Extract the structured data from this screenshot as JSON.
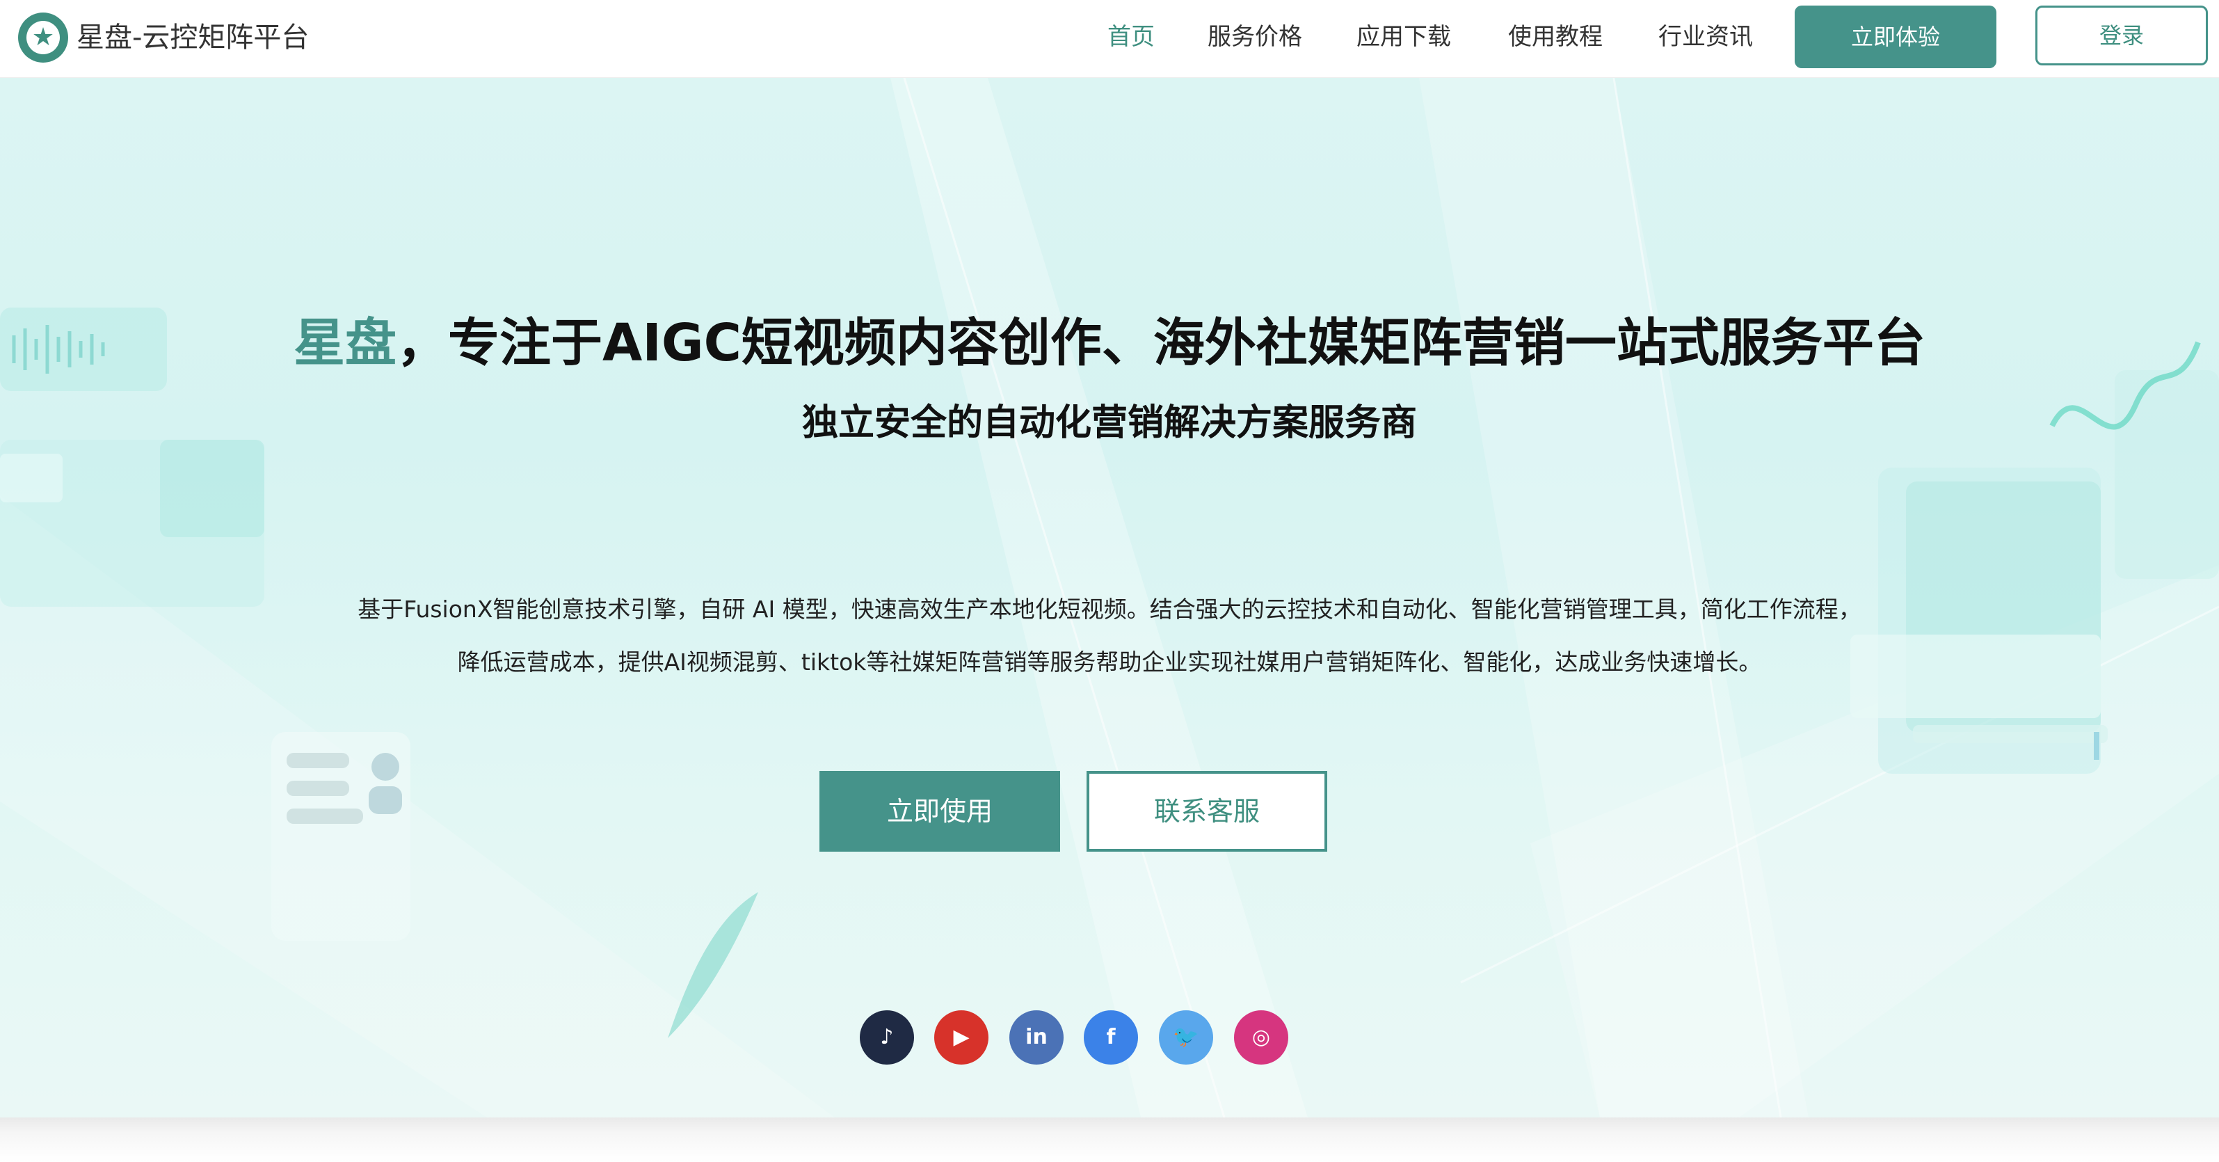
{
  "header": {
    "logo_text": "星盘-云控矩阵平台",
    "nav": [
      {
        "label": "首页",
        "active": true
      },
      {
        "label": "服务价格",
        "active": false
      },
      {
        "label": "应用下载",
        "active": false
      },
      {
        "label": "使用教程",
        "active": false
      },
      {
        "label": "行业资讯",
        "active": false
      }
    ],
    "cta_label": "立即体验",
    "login_label": "登录"
  },
  "hero": {
    "headline_brand": "星盘",
    "headline_rest": "，专注于AIGC短视频内容创作、海外社媒矩阵营销一站式服务平台",
    "subheadline": "独立安全的自动化营销解决方案服务商",
    "description_line1": "基于FusionX智能创意技术引擎，自研 AI 模型，快速高效生产本地化短视频。结合强大的云控技术和自动化、智能化营销管理工具，简化工作流程，",
    "description_line2": "降低运营成本，提供AI视频混剪、tiktok等社媒矩阵营销等服务帮助企业实现社媒用户营销矩阵化、智能化，达成业务快速增长。",
    "primary_button": "立即使用",
    "secondary_button": "联系客服"
  },
  "social": [
    {
      "name": "tiktok-icon",
      "glyph": "♪",
      "color": "#1f2a44"
    },
    {
      "name": "youtube-icon",
      "glyph": "▶",
      "color": "#d7322a"
    },
    {
      "name": "linkedin-icon",
      "glyph": "in",
      "color": "#4b72b6"
    },
    {
      "name": "facebook-icon",
      "glyph": "f",
      "color": "#3b82e8"
    },
    {
      "name": "twitter-icon",
      "glyph": "🐦",
      "color": "#59a7ec"
    },
    {
      "name": "instagram-icon",
      "glyph": "◎",
      "color": "#d6357f"
    }
  ],
  "colors": {
    "accent": "#45938a",
    "hero_bg": "#dcf5f3"
  }
}
